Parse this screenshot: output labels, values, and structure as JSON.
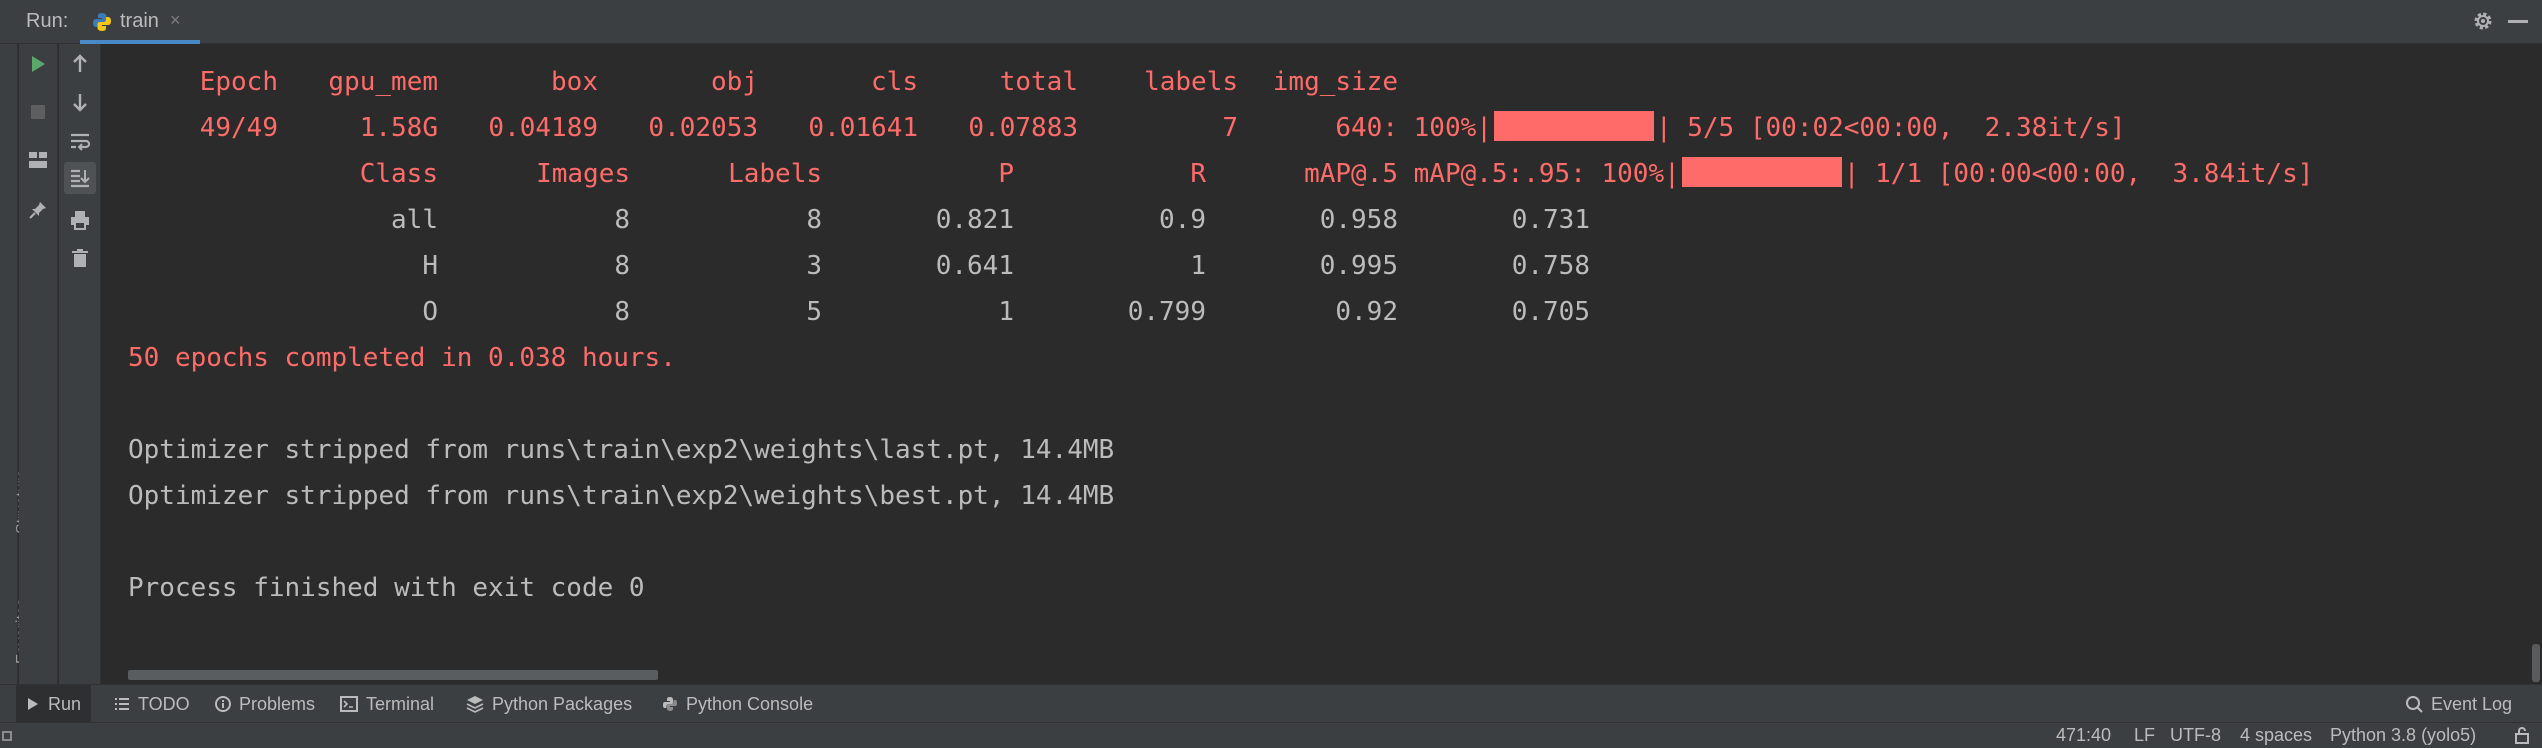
{
  "run_window": {
    "label": "Run:",
    "tab_title": "train",
    "tab_close": "×"
  },
  "side_tabs": {
    "structure": "Structure",
    "favorites": "Favorites"
  },
  "console": {
    "header": [
      "Epoch",
      "gpu_mem",
      "box",
      "obj",
      "cls",
      "total",
      "labels",
      "img_size"
    ],
    "epoch_row": [
      "49/49",
      "1.58G",
      "0.04189",
      "0.02053",
      "0.01641",
      "0.07883",
      "7",
      "640:"
    ],
    "epoch_progress": {
      "percent_label": "100%|",
      "after": "| 5/5 [00:02<00:00,  2.38it/s]",
      "fraction": 1.0
    },
    "val_header": [
      "Class",
      "Images",
      "Labels",
      "P",
      "R",
      "mAP@.5",
      "mAP@.5:.95:"
    ],
    "val_progress": {
      "percent_label": "100%|",
      "after": "| 1/1 [00:00<00:00,  3.84it/s]",
      "fraction": 1.0
    },
    "val_rows": [
      [
        "all",
        "8",
        "8",
        "0.821",
        "0.9",
        "0.958",
        "0.731"
      ],
      [
        "H",
        "8",
        "3",
        "0.641",
        "1",
        "0.995",
        "0.758"
      ],
      [
        "O",
        "8",
        "5",
        "1",
        "0.799",
        "0.92",
        "0.705"
      ]
    ],
    "completed": "50 epochs completed in 0.038 hours.",
    "optimizer_lines": [
      "Optimizer stripped from runs\\train\\exp2\\weights\\last.pt, 14.4MB",
      "Optimizer stripped from runs\\train\\exp2\\weights\\best.pt, 14.4MB"
    ],
    "exit_line": "Process finished with exit code 0"
  },
  "bottom_tabs": {
    "run": "Run",
    "todo": "TODO",
    "problems": "Problems",
    "terminal": "Terminal",
    "python_packages": "Python Packages",
    "python_console": "Python Console",
    "event_log": "Event Log"
  },
  "status_bar": {
    "position": "471:40",
    "line_sep": "LF",
    "encoding": "UTF-8",
    "indent": "4 spaces",
    "interpreter": "Python 3.8 (yolo5)"
  },
  "colors": {
    "error_red": "#ff6b68",
    "console_bg": "#2b2b2b",
    "panel_bg": "#3c3f41",
    "run_green": "#59a869"
  },
  "icons": [
    "python-icon",
    "gear-icon",
    "minimize-icon",
    "rerun-icon",
    "stop-icon",
    "layout-icon",
    "pin-icon",
    "up-arrow-icon",
    "down-arrow-icon",
    "soft-wrap-icon",
    "scroll-to-end-icon",
    "print-icon",
    "trash-icon",
    "list-icon",
    "info-icon",
    "terminal-icon",
    "layers-icon",
    "python-console-icon",
    "search-icon",
    "lock-icon"
  ]
}
